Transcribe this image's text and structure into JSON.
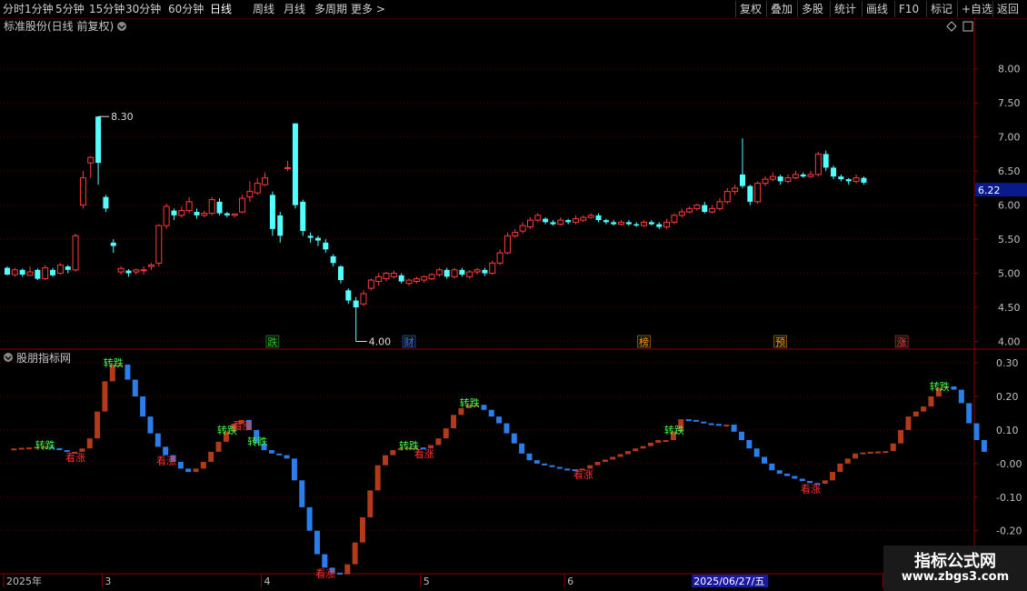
{
  "toolbar": {
    "periods": [
      "分时",
      "1分钟",
      "5分钟",
      "15分钟",
      "30分钟",
      "60分钟",
      "日线",
      "周线",
      "月线",
      "多周期",
      "更多 >"
    ],
    "active_period": "日线",
    "actions": [
      "复权",
      "叠加",
      "多股",
      "统计",
      "画线",
      "F10",
      "标记",
      "+自选",
      "返回"
    ]
  },
  "main_panel": {
    "title": "标准股份(日线 前复权)",
    "high_label": "8.30",
    "low_label": "4.00",
    "current_price_tag": "6.22",
    "event_markers": [
      {
        "label": "跌",
        "color": "#22cc22",
        "index": 35
      },
      {
        "label": "财",
        "color": "#3377ff",
        "index": 53
      },
      {
        "label": "榜",
        "color": "#ff9900",
        "index": 84
      },
      {
        "label": "预",
        "color": "#ff9900",
        "index": 102
      },
      {
        "label": "涨",
        "color": "#ff3333",
        "index": 118
      }
    ]
  },
  "indicator_panel": {
    "title": "股朋指标网",
    "up_label": "转跌",
    "down_label": "看涨",
    "signals": [
      {
        "text": "转跌",
        "index": 5,
        "type": "up"
      },
      {
        "text": "看涨",
        "index": 9,
        "type": "down"
      },
      {
        "text": "转跌",
        "index": 14,
        "type": "up"
      },
      {
        "text": "看涨",
        "index": 21,
        "type": "down"
      },
      {
        "text": "转跌",
        "index": 29,
        "type": "up"
      },
      {
        "text": "看涨",
        "index": 31,
        "type": "down"
      },
      {
        "text": "转跌",
        "index": 33,
        "type": "up"
      },
      {
        "text": "看涨",
        "index": 42,
        "type": "down"
      },
      {
        "text": "转跌",
        "index": 53,
        "type": "up"
      },
      {
        "text": "看涨",
        "index": 55,
        "type": "down"
      },
      {
        "text": "转跌",
        "index": 61,
        "type": "up"
      },
      {
        "text": "看涨",
        "index": 76,
        "type": "down"
      },
      {
        "text": "转跌",
        "index": 88,
        "type": "up"
      },
      {
        "text": "看涨",
        "index": 106,
        "type": "down"
      },
      {
        "text": "转跌",
        "index": 123,
        "type": "up"
      }
    ]
  },
  "bottom_axis": {
    "labels": [
      {
        "text": "2025年",
        "index": 0
      },
      {
        "text": "3",
        "index": 13
      },
      {
        "text": "4",
        "index": 34
      },
      {
        "text": "5",
        "index": 55
      },
      {
        "text": "6",
        "index": 74
      },
      {
        "text": "8",
        "index": 116
      }
    ],
    "cursor_date": "2025/06/27/五",
    "cursor_index": 92
  },
  "watermark": {
    "line1": "指标公式网",
    "line2": "www.zbgs3.com"
  },
  "chart_data": [
    {
      "type": "candlestick",
      "title": "标准股份(日线 前复权)",
      "ylim": [
        3.9,
        8.45
      ],
      "yticks": [
        4.0,
        4.5,
        5.0,
        5.5,
        6.0,
        6.5,
        7.0,
        7.5,
        8.0
      ],
      "up_color": "#ff3c3c",
      "down_color": "#54ffff",
      "candles": [
        [
          5.08,
          4.98,
          5.1,
          4.97
        ],
        [
          4.98,
          5.05,
          5.08,
          4.95
        ],
        [
          5.05,
          4.98,
          5.07,
          4.95
        ],
        [
          4.97,
          5.02,
          5.1,
          4.96
        ],
        [
          5.05,
          4.92,
          5.07,
          4.9
        ],
        [
          4.92,
          5.08,
          5.12,
          4.9
        ],
        [
          5.05,
          4.97,
          5.08,
          4.95
        ],
        [
          5.0,
          5.12,
          5.15,
          4.98
        ],
        [
          5.1,
          5.05,
          5.12,
          5.0
        ],
        [
          5.05,
          5.55,
          5.58,
          5.02
        ],
        [
          6.0,
          6.4,
          6.5,
          5.95
        ],
        [
          6.62,
          6.7,
          6.72,
          6.4
        ],
        [
          7.3,
          6.62,
          7.3,
          6.3
        ],
        [
          6.12,
          5.95,
          6.15,
          5.9
        ],
        [
          5.45,
          5.4,
          5.5,
          5.3
        ],
        [
          5.02,
          5.07,
          5.1,
          4.98
        ],
        [
          5.04,
          5.0,
          5.06,
          4.95
        ],
        [
          5.02,
          5.05,
          5.07,
          4.98
        ],
        [
          5.05,
          5.05,
          5.1,
          4.98
        ],
        [
          5.1,
          5.12,
          5.15,
          5.05
        ],
        [
          5.15,
          5.7,
          5.72,
          5.1
        ],
        [
          5.7,
          5.98,
          6.02,
          5.65
        ],
        [
          5.92,
          5.85,
          5.95,
          5.78
        ],
        [
          5.85,
          5.92,
          5.98,
          5.82
        ],
        [
          5.92,
          6.05,
          6.12,
          5.88
        ],
        [
          5.9,
          5.85,
          5.95,
          5.8
        ],
        [
          5.85,
          5.88,
          5.92,
          5.82
        ],
        [
          5.88,
          6.08,
          6.12,
          5.85
        ],
        [
          6.05,
          5.88,
          6.1,
          5.85
        ],
        [
          5.88,
          5.85,
          5.9,
          5.82
        ],
        [
          5.85,
          5.87,
          5.88,
          5.82
        ],
        [
          5.9,
          6.1,
          6.15,
          5.88
        ],
        [
          6.12,
          6.2,
          6.35,
          6.05
        ],
        [
          6.18,
          6.32,
          6.4,
          6.15
        ],
        [
          6.3,
          6.4,
          6.48,
          6.28
        ],
        [
          6.15,
          5.65,
          6.2,
          5.55
        ],
        [
          5.85,
          5.55,
          5.9,
          5.45
        ],
        [
          6.55,
          6.55,
          6.65,
          6.5
        ],
        [
          7.2,
          6.0,
          7.2,
          5.95
        ],
        [
          6.05,
          5.62,
          6.08,
          5.55
        ],
        [
          5.55,
          5.52,
          5.6,
          5.45
        ],
        [
          5.52,
          5.48,
          5.55,
          5.4
        ],
        [
          5.45,
          5.35,
          5.5,
          5.3
        ],
        [
          5.25,
          5.15,
          5.28,
          5.1
        ],
        [
          5.1,
          4.9,
          5.12,
          4.85
        ],
        [
          4.75,
          4.6,
          4.78,
          4.55
        ],
        [
          4.6,
          4.5,
          4.65,
          4.0
        ],
        [
          4.55,
          4.7,
          4.75,
          4.52
        ],
        [
          4.78,
          4.9,
          4.92,
          4.75
        ],
        [
          4.88,
          4.95,
          5.0,
          4.82
        ],
        [
          4.92,
          5.0,
          5.02,
          4.88
        ],
        [
          4.95,
          5.0,
          5.04,
          4.92
        ],
        [
          4.97,
          4.88,
          5.0,
          4.85
        ],
        [
          4.85,
          4.9,
          4.92,
          4.82
        ],
        [
          4.88,
          4.92,
          4.95,
          4.85
        ],
        [
          4.9,
          4.95,
          4.97,
          4.86
        ],
        [
          4.92,
          4.98,
          5.0,
          4.9
        ],
        [
          4.98,
          5.05,
          5.08,
          4.95
        ],
        [
          5.05,
          4.95,
          5.08,
          4.92
        ],
        [
          4.95,
          5.05,
          5.08,
          4.92
        ],
        [
          5.05,
          4.98,
          5.08,
          4.95
        ],
        [
          4.95,
          5.02,
          5.05,
          4.92
        ],
        [
          5.02,
          5.05,
          5.08,
          4.98
        ],
        [
          5.05,
          5.0,
          5.08,
          4.96
        ],
        [
          5.0,
          5.15,
          5.18,
          4.98
        ],
        [
          5.15,
          5.3,
          5.35,
          5.12
        ],
        [
          5.3,
          5.55,
          5.6,
          5.28
        ],
        [
          5.55,
          5.6,
          5.65,
          5.52
        ],
        [
          5.62,
          5.7,
          5.75,
          5.58
        ],
        [
          5.68,
          5.78,
          5.82,
          5.65
        ],
        [
          5.78,
          5.85,
          5.88,
          5.75
        ],
        [
          5.8,
          5.75,
          5.82,
          5.72
        ],
        [
          5.75,
          5.72,
          5.78,
          5.7
        ],
        [
          5.72,
          5.78,
          5.82,
          5.7
        ],
        [
          5.78,
          5.75,
          5.8,
          5.72
        ],
        [
          5.75,
          5.8,
          5.85,
          5.72
        ],
        [
          5.78,
          5.82,
          5.85,
          5.75
        ],
        [
          5.82,
          5.85,
          5.88,
          5.8
        ],
        [
          5.85,
          5.78,
          5.88,
          5.75
        ],
        [
          5.78,
          5.75,
          5.8,
          5.72
        ],
        [
          5.75,
          5.72,
          5.78,
          5.7
        ],
        [
          5.72,
          5.75,
          5.78,
          5.7
        ],
        [
          5.75,
          5.72,
          5.78,
          5.7
        ],
        [
          5.72,
          5.7,
          5.75,
          5.68
        ],
        [
          5.7,
          5.75,
          5.78,
          5.68
        ],
        [
          5.75,
          5.72,
          5.78,
          5.7
        ],
        [
          5.72,
          5.68,
          5.75,
          5.65
        ],
        [
          5.68,
          5.75,
          5.8,
          5.65
        ],
        [
          5.75,
          5.85,
          5.88,
          5.72
        ],
        [
          5.85,
          5.9,
          5.95,
          5.82
        ],
        [
          5.9,
          5.95,
          5.98,
          5.88
        ],
        [
          5.95,
          6.0,
          6.02,
          5.92
        ],
        [
          6.0,
          5.9,
          6.05,
          5.88
        ],
        [
          5.9,
          5.95,
          6.0,
          5.88
        ],
        [
          5.95,
          6.05,
          6.1,
          5.92
        ],
        [
          6.05,
          6.2,
          6.25,
          6.02
        ],
        [
          6.2,
          6.25,
          6.3,
          6.15
        ],
        [
          6.45,
          6.28,
          6.98,
          6.25
        ],
        [
          6.28,
          6.05,
          6.3,
          6.0
        ],
        [
          6.05,
          6.32,
          6.35,
          6.02
        ],
        [
          6.32,
          6.38,
          6.42,
          6.28
        ],
        [
          6.38,
          6.42,
          6.48,
          6.35
        ],
        [
          6.42,
          6.35,
          6.45,
          6.3
        ],
        [
          6.35,
          6.4,
          6.45,
          6.32
        ],
        [
          6.4,
          6.45,
          6.5,
          6.38
        ],
        [
          6.45,
          6.42,
          6.48,
          6.4
        ],
        [
          6.42,
          6.45,
          6.5,
          6.4
        ],
        [
          6.45,
          6.75,
          6.78,
          6.42
        ],
        [
          6.75,
          6.55,
          6.8,
          6.5
        ],
        [
          6.55,
          6.42,
          6.58,
          6.38
        ],
        [
          6.42,
          6.38,
          6.45,
          6.35
        ],
        [
          6.38,
          6.35,
          6.4,
          6.3
        ],
        [
          6.35,
          6.4,
          6.45,
          6.32
        ],
        [
          6.4,
          6.33,
          6.42,
          6.3
        ]
      ]
    },
    {
      "type": "bar",
      "title": "股朋指标网",
      "ylim": [
        -0.32,
        0.33
      ],
      "yticks": [
        0.3,
        0.2,
        0.1,
        0.0,
        -0.1,
        -0.2
      ],
      "ytick_labels": [
        "0.30",
        "0.20",
        "0.10",
        "-0.00",
        "-0.10",
        "-0.20"
      ],
      "up_color": "#b23a1a",
      "down_color": "#2b7de9",
      "values": [
        0.045,
        0.045,
        0.047,
        0.048,
        0.05,
        0.05,
        0.046,
        0.04,
        0.035,
        0.035,
        0.045,
        0.075,
        0.155,
        0.245,
        0.295,
        0.295,
        0.25,
        0.2,
        0.14,
        0.09,
        0.05,
        0.025,
        0.005,
        -0.015,
        -0.025,
        -0.015,
        0.005,
        0.035,
        0.065,
        0.095,
        0.118,
        0.13,
        0.1,
        0.06,
        0.04,
        0.03,
        0.025,
        0.015,
        -0.05,
        -0.13,
        -0.2,
        -0.27,
        -0.31,
        -0.325,
        -0.33,
        -0.3,
        -0.235,
        -0.16,
        -0.08,
        -0.005,
        0.025,
        0.04,
        0.045,
        0.048,
        0.048,
        0.045,
        0.055,
        0.075,
        0.105,
        0.145,
        0.165,
        0.175,
        0.175,
        0.16,
        0.14,
        0.12,
        0.09,
        0.06,
        0.03,
        0.01,
        0.0,
        -0.005,
        -0.01,
        -0.015,
        -0.017,
        -0.018,
        -0.015,
        -0.005,
        0.005,
        0.012,
        0.02,
        0.028,
        0.037,
        0.045,
        0.052,
        0.062,
        0.07,
        0.07,
        0.095,
        0.132,
        0.13,
        0.125,
        0.12,
        0.118,
        0.116,
        0.116,
        0.095,
        0.07,
        0.045,
        0.02,
        0.0,
        -0.02,
        -0.03,
        -0.037,
        -0.045,
        -0.052,
        -0.058,
        -0.06,
        -0.05,
        -0.025,
        0.0,
        0.015,
        0.03,
        0.033,
        0.035,
        0.036,
        0.037,
        0.06,
        0.1,
        0.14,
        0.155,
        0.17,
        0.2,
        0.225,
        0.23,
        0.22,
        0.18,
        0.12,
        0.07,
        0.035
      ]
    }
  ]
}
